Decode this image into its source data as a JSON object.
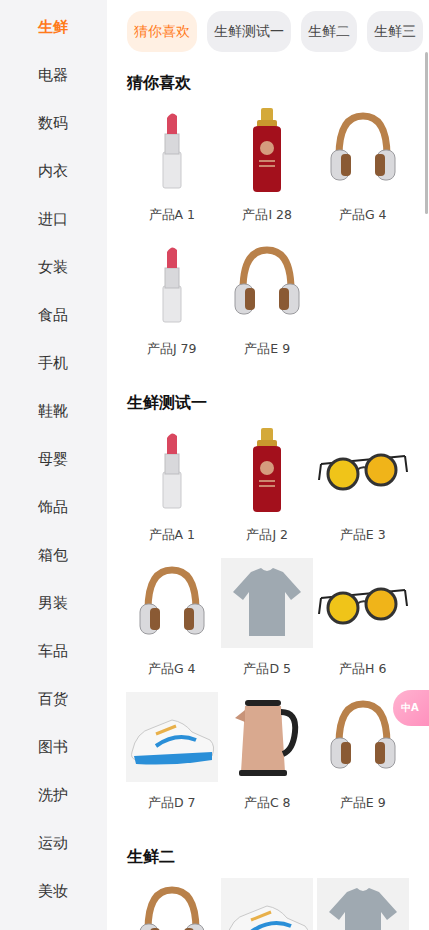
{
  "sidebar": {
    "items": [
      {
        "label": "生鲜",
        "selected": true
      },
      {
        "label": "电器",
        "selected": false
      },
      {
        "label": "数码",
        "selected": false
      },
      {
        "label": "内衣",
        "selected": false
      },
      {
        "label": "进口",
        "selected": false
      },
      {
        "label": "女装",
        "selected": false
      },
      {
        "label": "食品",
        "selected": false
      },
      {
        "label": "手机",
        "selected": false
      },
      {
        "label": "鞋靴",
        "selected": false
      },
      {
        "label": "母婴",
        "selected": false
      },
      {
        "label": "饰品",
        "selected": false
      },
      {
        "label": "箱包",
        "selected": false
      },
      {
        "label": "男装",
        "selected": false
      },
      {
        "label": "车品",
        "selected": false
      },
      {
        "label": "百货",
        "selected": false
      },
      {
        "label": "图书",
        "selected": false
      },
      {
        "label": "洗护",
        "selected": false
      },
      {
        "label": "运动",
        "selected": false
      },
      {
        "label": "美妆",
        "selected": false
      }
    ]
  },
  "tabs": [
    {
      "label": "猜你喜欢",
      "selected": true
    },
    {
      "label": "生鲜测试一",
      "selected": false
    },
    {
      "label": "生鲜二",
      "selected": false
    },
    {
      "label": "生鲜三",
      "selected": false
    }
  ],
  "sections": [
    {
      "title": "猜你喜欢",
      "products": [
        {
          "label": "产品A 1",
          "kind": "lipstick"
        },
        {
          "label": "产品I 28",
          "kind": "shampoo"
        },
        {
          "label": "产品G 4",
          "kind": "headphones"
        },
        {
          "label": "产品J 79",
          "kind": "lipstick"
        },
        {
          "label": "产品E 9",
          "kind": "headphones"
        }
      ]
    },
    {
      "title": "生鲜测试一",
      "products": [
        {
          "label": "产品A 1",
          "kind": "lipstick"
        },
        {
          "label": "产品J 2",
          "kind": "shampoo"
        },
        {
          "label": "产品E 3",
          "kind": "sunglasses"
        },
        {
          "label": "产品G 4",
          "kind": "headphones"
        },
        {
          "label": "产品D 5",
          "kind": "shirt"
        },
        {
          "label": "产品H 6",
          "kind": "sunglasses"
        },
        {
          "label": "产品D 7",
          "kind": "sneaker"
        },
        {
          "label": "产品C 8",
          "kind": "kettle"
        },
        {
          "label": "产品E 9",
          "kind": "headphones"
        }
      ]
    },
    {
      "title": "生鲜二",
      "products": [
        {
          "kind": "headphones"
        },
        {
          "kind": "sneaker"
        },
        {
          "kind": "shirt"
        }
      ]
    }
  ],
  "floating_button": {
    "label": "中A"
  }
}
